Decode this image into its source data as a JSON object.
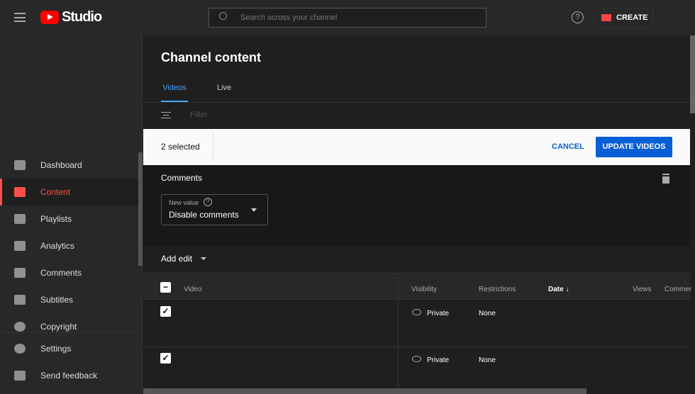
{
  "header": {
    "logo_text": "Studio",
    "search_placeholder": "Search across your channel",
    "create_label": "CREATE"
  },
  "sidebar": {
    "items": [
      {
        "label": "Dashboard"
      },
      {
        "label": "Content"
      },
      {
        "label": "Playlists"
      },
      {
        "label": "Analytics"
      },
      {
        "label": "Comments"
      },
      {
        "label": "Subtitles"
      },
      {
        "label": "Copyright"
      }
    ],
    "settings": "Settings",
    "feedback": "Send feedback"
  },
  "main": {
    "title": "Channel content",
    "tabs": [
      {
        "label": "Videos"
      },
      {
        "label": "Live"
      }
    ],
    "filter_placeholder": "Filter",
    "selection": {
      "count": "2 selected",
      "cancel": "CANCEL",
      "update": "UPDATE VIDEOS"
    },
    "edit": {
      "section": "Comments",
      "field_label": "New value",
      "field_value": "Disable comments",
      "add_edit": "Add edit"
    },
    "table": {
      "columns": [
        "Video",
        "Visibility",
        "Restrictions",
        "Date",
        "Views",
        "Commer"
      ],
      "rows": [
        {
          "visibility": "Private",
          "restrictions": "None"
        },
        {
          "visibility": "Private",
          "restrictions": "None"
        }
      ]
    }
  },
  "colors": {
    "accent": "#3ea6ff",
    "brand": "#ff0000",
    "button": "#065fd4"
  }
}
